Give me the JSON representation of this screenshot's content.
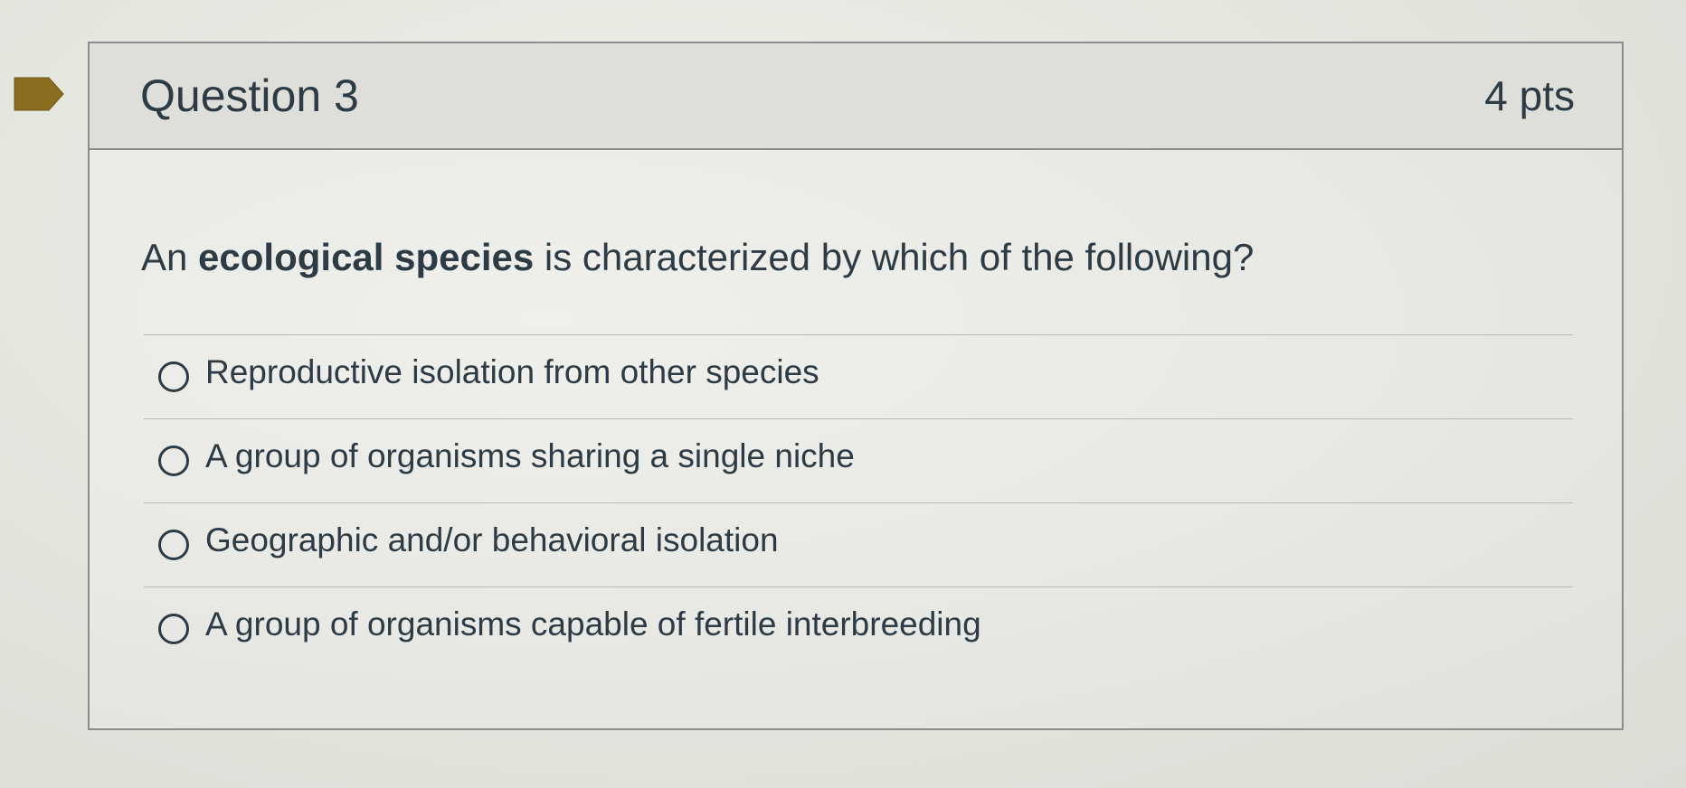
{
  "question": {
    "title": "Question 3",
    "points": "4 pts",
    "text_prefix": "An ",
    "text_bold": "ecological species",
    "text_suffix": " is characterized by which of the following?"
  },
  "answers": [
    {
      "label": "Reproductive isolation from other species",
      "selected": false
    },
    {
      "label": "A group of organisms sharing a single niche",
      "selected": false
    },
    {
      "label": "Geographic and/or behavioral isolation",
      "selected": false
    },
    {
      "label": "A group of organisms capable of fertile interbreeding",
      "selected": false
    }
  ],
  "colors": {
    "flag": "#8a6d1e",
    "text": "#2d3b45",
    "border": "#8a8d8e",
    "header_bg": "#dededa"
  },
  "icons": {
    "flag": "flag-marker-icon",
    "radio": "radio-circle-icon"
  }
}
